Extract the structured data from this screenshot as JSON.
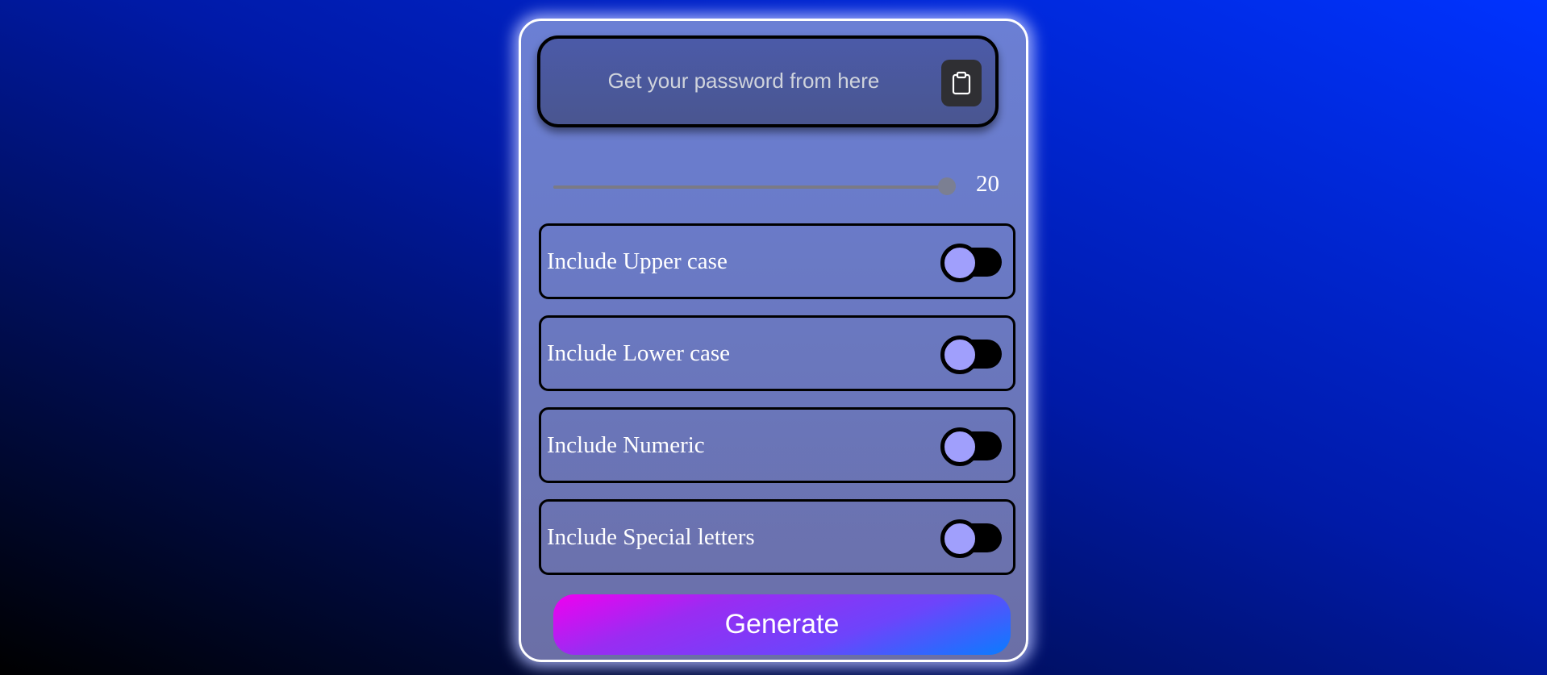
{
  "output": {
    "placeholder": "Get your password from here",
    "value": ""
  },
  "copy_button": {
    "icon": "clipboard-icon"
  },
  "length_slider": {
    "min": 0,
    "max": 20,
    "value": 20,
    "value_label": "20"
  },
  "options": [
    {
      "label": "Include Upper case",
      "checked": false
    },
    {
      "label": "Include Lower case",
      "checked": false
    },
    {
      "label": "Include Numeric",
      "checked": false
    },
    {
      "label": "Include Special letters",
      "checked": false
    }
  ],
  "generate_button": {
    "label": "Generate"
  },
  "colors": {
    "background_light": "#0033ff",
    "background_dark": "#000000",
    "card_border": "#ffffff",
    "toggle_knob": "#a09ffc",
    "button_gradient_start": "#f000f0",
    "button_gradient_end": "#0a7cff"
  }
}
